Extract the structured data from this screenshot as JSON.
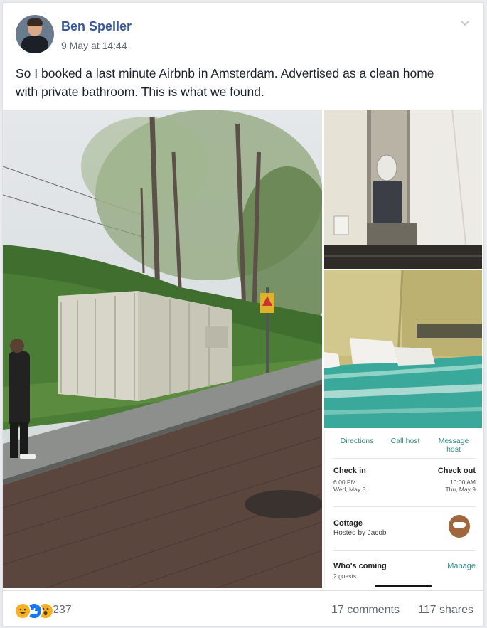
{
  "post": {
    "author": "Ben Speller",
    "timestamp": "9 May at 14:44",
    "text": "So I booked a last minute Airbnb in Amsterdam. Advertised as a clean home with private bathroom. This is what we found."
  },
  "app": {
    "actions": [
      "Directions",
      "Call host",
      "Message host"
    ],
    "check_in_label": "Check in",
    "check_in_time": "6:00 PM",
    "check_in_date": "Wed, May 8",
    "check_out_label": "Check out",
    "check_out_time": "10:00 AM",
    "check_out_date": "Thu, May 9",
    "listing_type": "Cottage",
    "host": "Hosted by Jacob",
    "whos_coming": "Who's coming",
    "guests": "2 guests",
    "manage": "Manage"
  },
  "footer": {
    "reaction_count": "237",
    "comments": "17 comments",
    "shares": "117 shares"
  },
  "icons": [
    "chevron-down-icon",
    "haha-reaction-icon",
    "like-reaction-icon",
    "wow-reaction-icon"
  ]
}
